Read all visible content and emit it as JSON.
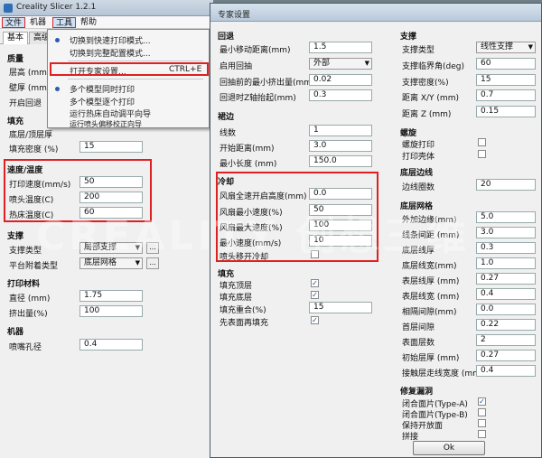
{
  "main_window": {
    "title": "Creality Slicer 1.2.1",
    "menubar": {
      "file": "文件",
      "machine": "机器",
      "tools": "工具",
      "help": "帮助"
    },
    "tabs": {
      "basic": "基本",
      "advanced": "高级"
    },
    "quality": {
      "header": "质量",
      "layer_height_label": "层高 (mm)",
      "wall_thickness_label": "壁厚 (mm)",
      "retraction_label": "开启回退"
    },
    "fill": {
      "header": "填充",
      "bottom_top_label": "底层/顶层厚",
      "density_label": "填充密度 (%)",
      "density_value": "15"
    },
    "speed_temp": {
      "header": "速度/温度",
      "print_speed_label": "打印速度(mm/s)",
      "print_speed_value": "50",
      "nozzle_temp_label": "喷头温度(C)",
      "nozzle_temp_value": "200",
      "bed_temp_label": "热床温度(C)",
      "bed_temp_value": "60"
    },
    "support": {
      "header": "支撑",
      "type_label": "支撑类型",
      "type_value": "局部支撑",
      "platform_label": "平台附着类型",
      "platform_value": "底层网格",
      "more": "..."
    },
    "filament": {
      "header": "打印材料",
      "diameter_label": "直径 (mm)",
      "diameter_value": "1.75",
      "flow_label": "挤出量(%)",
      "flow_value": "100"
    },
    "machine": {
      "header": "机器",
      "nozzle_label": "喷嘴孔径",
      "nozzle_value": "0.4"
    }
  },
  "tools_menu": {
    "items": [
      {
        "label": "切换到快速打印模式..."
      },
      {
        "label": "切换到完整配置模式..."
      },
      {
        "label": "打开专家设置...",
        "shortcut": "CTRL+E"
      },
      {
        "label": "多个模型同时打印"
      },
      {
        "label": "多个模型逐个打印"
      },
      {
        "label": "运行热床自动调平向导"
      },
      {
        "label": "运行喷头偏移校正向导"
      }
    ]
  },
  "expert": {
    "title": "专家设置",
    "retraction": {
      "header": "回退",
      "min_travel_label": "最小移动距离(mm)",
      "min_travel_value": "1.5",
      "enable_combing_label": "启用回抽",
      "enable_combing_value": "外部",
      "min_extrusion_label": "回抽前的最小挤出量(mm)",
      "min_extrusion_value": "0.02",
      "z_hop_label": "回退时Z轴抬起(mm)",
      "z_hop_value": "0.3"
    },
    "skirt": {
      "header": "裙边",
      "lines_label": "线数",
      "lines_value": "1",
      "distance_label": "开始距离(mm)",
      "distance_value": "3.0",
      "min_length_label": "最小长度 (mm)",
      "min_length_value": "150.0"
    },
    "cool": {
      "header": "冷却",
      "fan_full_label": "风扇全速开启高度(mm)",
      "fan_full_value": "0.0",
      "fan_min_label": "风扇最小速度(%)",
      "fan_min_value": "50",
      "fan_max_label": "风扇最大速度(%)",
      "fan_max_value": "100",
      "min_speed_label": "最小速度(mm/s)",
      "min_speed_value": "10",
      "cool_head_label": "喷头移开冷却"
    },
    "infill": {
      "header": "填充",
      "solid_top_label": "填充顶层",
      "solid_bottom_label": "填充底层",
      "overlap_label": "填充重合(%)",
      "overlap_value": "15",
      "infill_first_label": "先表面再填充"
    },
    "support": {
      "header": "支撑",
      "type_label": "支撑类型",
      "type_value": "线性支撑",
      "angle_label": "支撑临界角(deg)",
      "angle_value": "60",
      "density_label": "支撑密度(%)",
      "density_value": "15",
      "xy_label": "距离 X/Y (mm)",
      "xy_value": "0.7",
      "z_label": "距离 Z (mm)",
      "z_value": "0.15"
    },
    "spiral": {
      "header": "螺旋",
      "spiralize_label": "螺旋打印",
      "only_outer_label": "打印壳体"
    },
    "brim": {
      "header": "底层边线",
      "line_count_label": "边线圈数",
      "line_count_value": "20"
    },
    "raft": {
      "header": "底层网格",
      "margin_label": "外加边缘(mm)",
      "margin_value": "5.0",
      "line_spacing_label": "线条间距 (mm)",
      "line_spacing_value": "3.0",
      "base_thickness_label": "底层线厚",
      "base_thickness_value": "0.3",
      "base_width_label": "底层线宽(mm)",
      "base_width_value": "1.0",
      "interface_thickness_label": "表层线厚 (mm)",
      "interface_thickness_value": "0.27",
      "interface_width_label": "表层线宽 (mm)",
      "interface_width_value": "0.4",
      "airgap_label": "相隔间隙(mm)",
      "airgap_value": "0.0",
      "first_gap_label": "首层间隙",
      "first_gap_value": "0.22",
      "surface_layers_label": "表面层数",
      "surface_layers_value": "2",
      "surface_thickness_label": "初始层厚 (mm)",
      "surface_thickness_value": "0.27",
      "surface_width_label": "接触层走线宽度 (mm)",
      "surface_width_value": "0.4"
    },
    "fix": {
      "header": "修复漏洞",
      "type_a_label": "闭合面片(Type-A)",
      "type_b_label": "闭合面片(Type-B)",
      "keep_open_label": "保持开放面",
      "extensive_label": "拼接"
    },
    "ok_label": "Ok"
  },
  "watermark": "CREALITY 创想三维",
  "colors": {
    "highlight": "#e02020",
    "accent": "#2a5db0"
  }
}
